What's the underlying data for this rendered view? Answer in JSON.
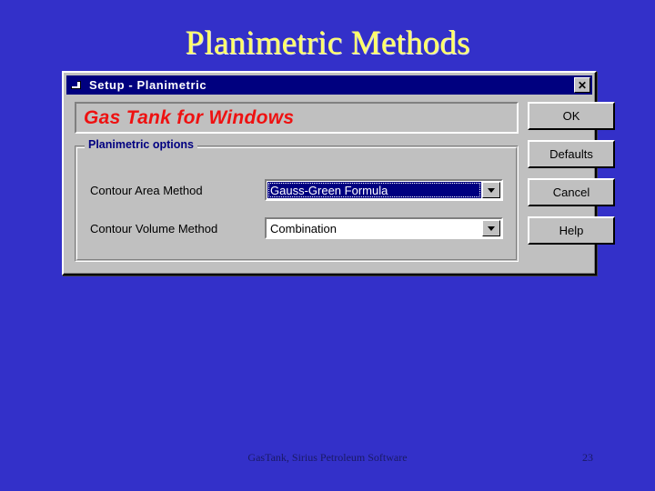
{
  "slide": {
    "title": "Planimetric Methods",
    "background_color": "#3330c9",
    "title_color": "#ffff66",
    "footer_text": "GasTank, Sirius Petroleum Software",
    "page_number": "23"
  },
  "dialog": {
    "titlebar": {
      "title": "Setup - Planimetric",
      "icon": "app-window-icon",
      "close_label": "✕",
      "background_color": "#00007f"
    },
    "banner": {
      "text": "Gas Tank for Windows",
      "color": "#ee1111"
    },
    "groupbox": {
      "label": "Planimetric options",
      "label_color": "#000080",
      "fields": [
        {
          "label": "Contour Area Method",
          "value": "Gauss-Green Formula",
          "selected": true,
          "arrow_icon": "chevron-down-icon"
        },
        {
          "label": "Contour Volume Method",
          "value": "Combination",
          "selected": false,
          "arrow_icon": "chevron-down-icon"
        }
      ]
    },
    "buttons": [
      {
        "label": "OK",
        "name": "ok-button"
      },
      {
        "label": "Defaults",
        "name": "defaults-button"
      },
      {
        "label": "Cancel",
        "name": "cancel-button"
      },
      {
        "label": "Help",
        "name": "help-button"
      }
    ]
  }
}
